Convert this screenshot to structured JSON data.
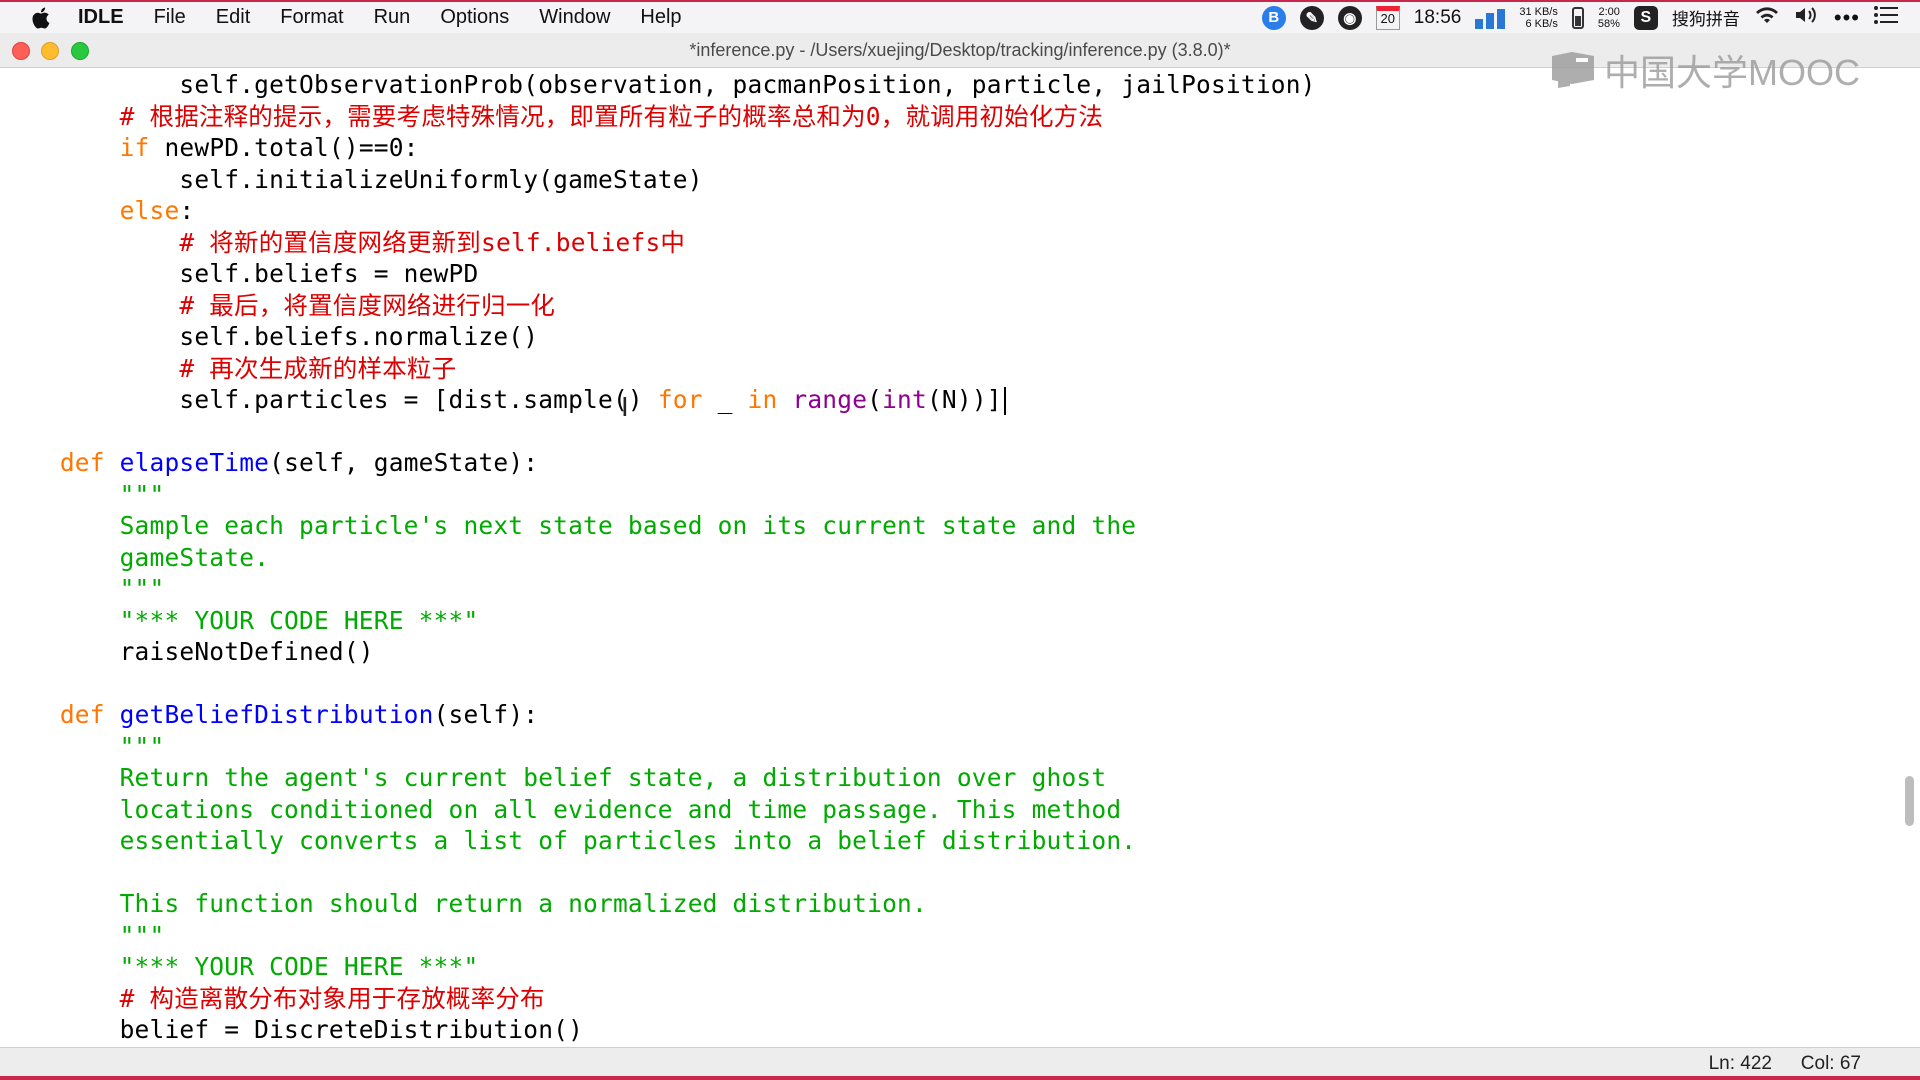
{
  "menubar": {
    "app": "IDLE",
    "items": [
      "File",
      "Edit",
      "Format",
      "Run",
      "Options",
      "Window",
      "Help"
    ],
    "calendar_day": "20",
    "clock": "18:56",
    "net_up": "31 KB/s",
    "net_down": "6 KB/s",
    "battery_time": "2:00",
    "battery_pct": "58%",
    "ime": "搜狗拼音",
    "icons": [
      "apple-icon",
      "bluetooth-app-icon",
      "pen-app-icon",
      "obs-icon",
      "calendar-icon",
      "cpu-meter-icon",
      "network-meter-icon",
      "battery-icon",
      "sogou-icon",
      "wifi-icon",
      "volume-icon",
      "more-icon",
      "list-icon"
    ]
  },
  "window": {
    "title": "*inference.py - /Users/xuejing/Desktop/tracking/inference.py (3.8.0)*"
  },
  "watermark": "中国大学MOOC",
  "code_lines": [
    [
      {
        "t": "            self.getObservationProb(observation, pacmanPosition, particle, jailPosition)"
      }
    ],
    [
      {
        "t": "        "
      },
      {
        "t": "# 根据注释的提示，需要考虑特殊情况，即置所有粒子的概率总和为0，就调用初始化方法",
        "c": "cm"
      }
    ],
    [
      {
        "t": "        "
      },
      {
        "t": "if",
        "c": "kw"
      },
      {
        "t": " newPD.total()==0:"
      }
    ],
    [
      {
        "t": "            self.initializeUniformly(gameState)"
      }
    ],
    [
      {
        "t": "        "
      },
      {
        "t": "else",
        "c": "kw"
      },
      {
        "t": ":"
      }
    ],
    [
      {
        "t": "            "
      },
      {
        "t": "# 将新的置信度网络更新到self.beliefs中",
        "c": "cm"
      }
    ],
    [
      {
        "t": "            self.beliefs = newPD"
      }
    ],
    [
      {
        "t": "            "
      },
      {
        "t": "# 最后，将置信度网络进行归一化",
        "c": "cm"
      }
    ],
    [
      {
        "t": "            self.beliefs.normalize()"
      }
    ],
    [
      {
        "t": "            "
      },
      {
        "t": "# 再次生成新的样本粒子",
        "c": "cm"
      }
    ],
    [
      {
        "t": "            self.particles = [dist.sample() "
      },
      {
        "t": "for",
        "c": "kw"
      },
      {
        "t": " _ "
      },
      {
        "t": "in",
        "c": "kw"
      },
      {
        "t": " "
      },
      {
        "t": "range",
        "c": "bi"
      },
      {
        "t": "("
      },
      {
        "t": "int",
        "c": "bi"
      },
      {
        "t": "(N))]"
      },
      {
        "caret": true
      }
    ],
    [
      {
        "t": ""
      }
    ],
    [
      {
        "t": "    "
      },
      {
        "t": "def",
        "c": "kw"
      },
      {
        "t": " "
      },
      {
        "t": "elapseTime",
        "c": "fn"
      },
      {
        "t": "(self, gameState):"
      }
    ],
    [
      {
        "t": "        \"\"\"",
        "c": "st"
      }
    ],
    [
      {
        "t": "        Sample each particle's next state based on its current state and the",
        "c": "st"
      }
    ],
    [
      {
        "t": "        gameState.",
        "c": "st"
      }
    ],
    [
      {
        "t": "        \"\"\"",
        "c": "st"
      }
    ],
    [
      {
        "t": "        \"*** YOUR CODE HERE ***\"",
        "c": "st"
      }
    ],
    [
      {
        "t": "        raiseNotDefined()"
      }
    ],
    [
      {
        "t": ""
      }
    ],
    [
      {
        "t": "    "
      },
      {
        "t": "def",
        "c": "kw"
      },
      {
        "t": " "
      },
      {
        "t": "getBeliefDistribution",
        "c": "fn"
      },
      {
        "t": "(self):"
      }
    ],
    [
      {
        "t": "        \"\"\"",
        "c": "st"
      }
    ],
    [
      {
        "t": "        Return the agent's current belief state, a distribution over ghost",
        "c": "st"
      }
    ],
    [
      {
        "t": "        locations conditioned on all evidence and time passage. This method",
        "c": "st"
      }
    ],
    [
      {
        "t": "        essentially converts a list of particles into a belief distribution.",
        "c": "st"
      }
    ],
    [
      {
        "t": ""
      }
    ],
    [
      {
        "t": "        This function should return a normalized distribution.",
        "c": "st"
      }
    ],
    [
      {
        "t": "        \"\"\"",
        "c": "st"
      }
    ],
    [
      {
        "t": "        \"*** YOUR CODE HERE ***\"",
        "c": "st"
      }
    ],
    [
      {
        "t": "        "
      },
      {
        "t": "# 构造离散分布对象用于存放概率分布",
        "c": "cm"
      }
    ],
    [
      {
        "t": "        belief = DiscreteDistribution()"
      }
    ]
  ],
  "statusbar": {
    "line": "Ln: 422",
    "col": "Col: 67"
  }
}
